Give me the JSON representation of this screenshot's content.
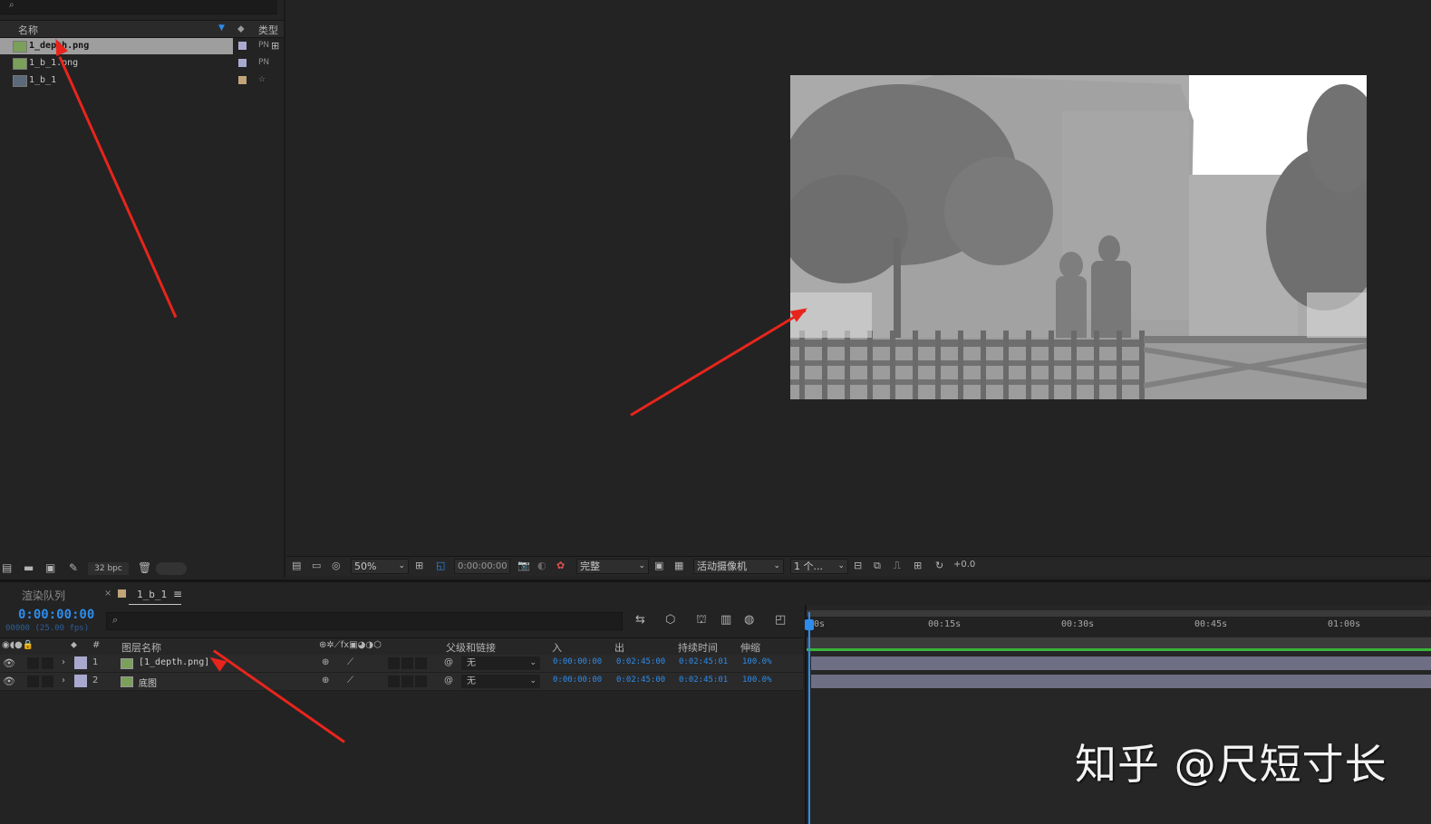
{
  "project": {
    "col_name": "名称",
    "col_type": "类型",
    "items": [
      {
        "name": "1_depth.png",
        "type": "PN",
        "label_color": "#a9a9d0",
        "selected": true
      },
      {
        "name": "1_b_1.png",
        "type": "PN",
        "label_color": "#a9a9d0",
        "selected": false
      },
      {
        "name": "1_b_1",
        "type": "☆",
        "label_color": "#c2a47a",
        "selected": false
      }
    ],
    "bit_depth": "32 bpc"
  },
  "viewer": {
    "zoom": "50%",
    "timecode": "0:00:00:00",
    "resolution": "完整",
    "camera": "活动摄像机",
    "views": "1 个...",
    "exposure": "+0.0"
  },
  "timeline": {
    "tab_render_queue": "渲染队列",
    "tab_comp": "1_b_1",
    "current_time": "0:00:00:00",
    "frame_info": "00000 (25.00 fps)",
    "headers": {
      "num": "#",
      "layer_name": "图层名称",
      "parent": "父级和链接",
      "in": "入",
      "out": "出",
      "duration": "持续时间",
      "stretch": "伸缩"
    },
    "layers": [
      {
        "num": "1",
        "name": "[1_depth.png]",
        "label_color": "#a9a9d0",
        "parent": "无",
        "in": "0:00:00:00",
        "out": "0:02:45:00",
        "duration": "0:02:45:01",
        "stretch": "100.0%"
      },
      {
        "num": "2",
        "name": "底图",
        "label_color": "#a9a9d0",
        "parent": "无",
        "in": "0:00:00:00",
        "out": "0:02:45:00",
        "duration": "0:02:45:01",
        "stretch": "100.0%"
      }
    ],
    "ruler": [
      "0s",
      "00:15s",
      "00:30s",
      "00:45s",
      "01:00s"
    ]
  },
  "watermark": "知乎 @尺短寸长",
  "colors": {
    "accent_blue": "#2d8ceb",
    "arrow_red": "#e8251c",
    "track": "#6e6e84",
    "work_area_green": "#3bb33b"
  }
}
